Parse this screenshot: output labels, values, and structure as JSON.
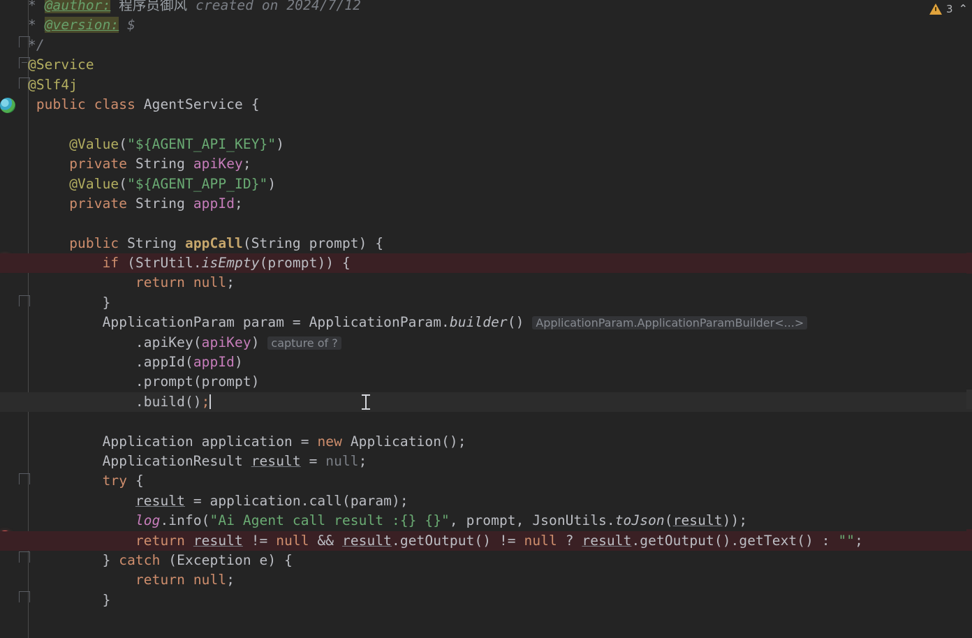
{
  "app": {
    "name": "IntelliJ IDEA Editor",
    "file": "AgentService.java",
    "language": "Java",
    "theme": "Dark",
    "background_color": "#242424",
    "breakpoint_line_color": "#3a2024",
    "current_line_color": "#2c2c2c"
  },
  "inspection_widget": {
    "warning_icon": "warning-triangle-icon",
    "warning_count": "3",
    "collapse_icon": "chevron-up-icon",
    "chevron": "⌃"
  },
  "gutter": {
    "breakpoint_icon": "breakpoint-dot-icon",
    "fold_icon": "code-fold-marker-icon",
    "bean_icon": "spring-bean-icon"
  },
  "caret": {
    "line": ".build();",
    "column_after": ";"
  },
  "mouse_cursor": {
    "icon": "text-ibeam-cursor",
    "x": "518",
    "y": "564"
  },
  "code": {
    "comment": {
      "star": "*",
      "author_tag": "@author:",
      "author_name": "程序员御风",
      "created_on": "created on 2024/7/12",
      "version_tag": "@version:",
      "version_value": "$",
      "close": "*/"
    },
    "annotations": {
      "service": "@Service",
      "slf4j": "@Slf4j",
      "value": "@Value",
      "value_api_key_arg": "\"${AGENT_API_KEY}\"",
      "value_app_id_arg": "\"${AGENT_APP_ID}\""
    },
    "class_decl": {
      "public": "public",
      "class": "class",
      "name": "AgentService",
      "brace": "{"
    },
    "fields": [
      {
        "modifier": "private",
        "type": "String",
        "name": "apiKey",
        "semi": ";"
      },
      {
        "modifier": "private",
        "type": "String",
        "name": "appId",
        "semi": ";"
      }
    ],
    "method": {
      "modifier": "public",
      "return_type": "String",
      "name": "appCall",
      "param_type": "String",
      "param_name": "prompt"
    },
    "if_stmt": {
      "kw": "if",
      "cls": "StrUtil",
      "method": "isEmpty",
      "arg": "prompt"
    },
    "return_null": {
      "kw": "return",
      "value": "null",
      "semi": ";"
    },
    "builder": {
      "type": "ApplicationParam",
      "var": "param",
      "eq": "=",
      "cls": "ApplicationParam",
      "method": "builder",
      "hint": "ApplicationParam.ApplicationParamBuilder<...>",
      "chain": [
        {
          "method": ".apiKey",
          "arg": "apiKey",
          "hint": "capture of ?"
        },
        {
          "method": ".appId",
          "arg": "appId",
          "hint": ""
        },
        {
          "method": ".prompt",
          "arg": "prompt",
          "hint": ""
        },
        {
          "method": ".build",
          "arg": "",
          "hint": ""
        }
      ]
    },
    "application_decl": {
      "type": "Application",
      "var": "application",
      "eq": "=",
      "new": "new",
      "ctor": "Application"
    },
    "result_decl": {
      "type": "ApplicationResult",
      "var": "result",
      "eq": "=",
      "value": "null"
    },
    "try_kw": "try",
    "call_stmt": {
      "var": "result",
      "eq": "=",
      "obj": "application",
      "method": "call",
      "arg": "param"
    },
    "log_stmt": {
      "logger": "log",
      "method": "info",
      "message": "\"Ai Agent call result :{} {}\"",
      "arg1": "prompt",
      "util": "JsonUtils",
      "util_method": "toJson",
      "util_arg": "result"
    },
    "return_ternary": {
      "kw": "return",
      "a": "result",
      "ne1": "!=",
      "null1": "null",
      "and": "&&",
      "b": "result",
      "b_method": ".getOutput()",
      "ne2": "!=",
      "null2": "null",
      "q": "?",
      "then": "result",
      "then_method": ".getOutput().getText()",
      "colon": ":",
      "else_value": "\"\"",
      "semi": ";"
    },
    "catch_clause": {
      "close": "}",
      "kw": "catch",
      "ex_type": "Exception",
      "ex_var": "e",
      "brace": "{"
    },
    "close_brace": "}"
  }
}
